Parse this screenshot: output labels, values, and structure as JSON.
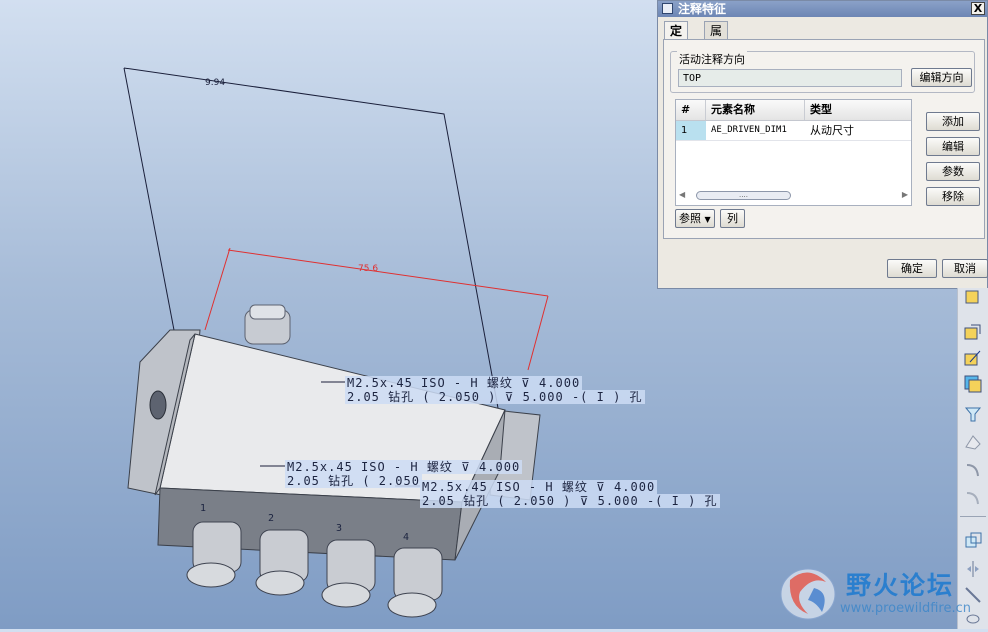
{
  "dialog": {
    "title": "注释特征",
    "close_label": "X",
    "tabs": [
      "定义",
      "属性"
    ],
    "active_tab": "定义",
    "orientation_group_label": "活动注释方向",
    "orientation_value": "TOP",
    "edit_orientation_label": "编辑方向",
    "table": {
      "columns": [
        "#",
        "元素名称",
        "类型"
      ],
      "rows": [
        {
          "num": "1",
          "name": "AE_DRIVEN_DIM1",
          "type": "从动尺寸"
        }
      ],
      "scroll_thumb": "...."
    },
    "side_buttons": [
      "添加",
      "编辑",
      "参数",
      "移除"
    ],
    "ref_dropdown_label": "参照",
    "column_button_label": "列",
    "ok_label": "确定",
    "cancel_label": "取消"
  },
  "annotations": {
    "a1_line1": "M2.5x.45 ISO - H 螺纹 ⊽ 4.000",
    "a1_line2": "2.05 钻孔 ( 2.050 ) ⊽ 5.000  -( I ) 孔",
    "a2_line1": "M2.5x.45 ISO - H 螺纹 ⊽ 4.000",
    "a2_line2": "2.05 钻孔 ( 2.050",
    "a3_line1": "M2.5x.45 ISO - H 螺纹 ⊽ 4.000",
    "a3_line2": "2.05 钻孔 ( 2.050 ) ⊽ 5.000  -( I ) 孔",
    "dim_red": "75.6",
    "dim_black": "9.94"
  },
  "connector_labels": [
    "1",
    "2",
    "3",
    "4"
  ],
  "watermark": {
    "cn": "野火论坛",
    "url": "www.proewildfire.cn"
  },
  "colors": {
    "accent_blue": "#1c7ad0",
    "dimension_red": "#e03030",
    "selection_cyan": "#b9e0ef",
    "part_gray": "#d6d8dc"
  }
}
